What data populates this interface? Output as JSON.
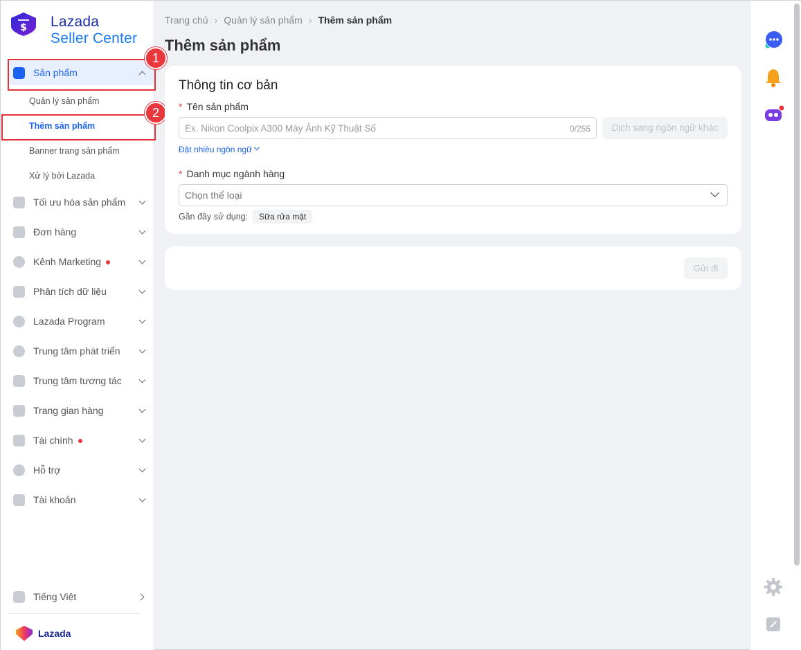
{
  "brand": {
    "line1": "Lazada",
    "line2": "Seller Center",
    "footer": "Lazada"
  },
  "sidebar": {
    "items": [
      {
        "label": "Sản phẩm",
        "icon": "bag-icon",
        "expanded": true
      },
      {
        "label": "Tối ưu hóa sản phẩm",
        "icon": "chart-up-icon"
      },
      {
        "label": "Đơn hàng",
        "icon": "order-icon"
      },
      {
        "label": "Kênh Marketing",
        "icon": "marketing-icon",
        "dot": true
      },
      {
        "label": "Phân tích dữ liệu",
        "icon": "analytics-icon"
      },
      {
        "label": "Lazada Program",
        "icon": "program-icon"
      },
      {
        "label": "Trung tâm phát triển",
        "icon": "growth-icon"
      },
      {
        "label": "Trung tâm tương tác",
        "icon": "engagement-icon"
      },
      {
        "label": "Trang gian hàng",
        "icon": "store-icon"
      },
      {
        "label": "Tài chính",
        "icon": "wallet-icon",
        "dot": true
      },
      {
        "label": "Hỗ trợ",
        "icon": "help-icon"
      },
      {
        "label": "Tài khoản",
        "icon": "account-icon"
      }
    ],
    "sub_items": [
      "Quản lý sản phẩm",
      "Thêm sản phẩm",
      "Banner trang sản phẩm",
      "Xử lý bởi Lazada"
    ],
    "active_sub": "Thêm sản phẩm",
    "language": "Tiếng Việt"
  },
  "annotations": [
    "1",
    "2"
  ],
  "breadcrumb": [
    "Trang chủ",
    "Quản lý sản phẩm",
    "Thêm sản phẩm"
  ],
  "page_title": "Thêm sản phẩm",
  "form": {
    "section_title": "Thông tin cơ bản",
    "name_label": "Tên sản phẩm",
    "name_placeholder": "Ex. Nikon Coolpix A300 Máy Ảnh Kỹ Thuật Số",
    "name_counter": "0/255",
    "translate_button": "Dịch sang ngôn ngữ khác",
    "multi_lang_link": "Đặt nhiều ngôn ngữ",
    "category_label": "Danh mục ngành hàng",
    "category_placeholder": "Chọn thể loại",
    "recent_label": "Gần đây sử dụng:",
    "recent_chip": "Sữa rửa mặt",
    "submit_button": "Gửi đi"
  },
  "colors": {
    "accent": "#1a63f0",
    "brand_dark": "#1a2ba8",
    "annotation": "#e4323a",
    "notify": "#f5a11c"
  }
}
